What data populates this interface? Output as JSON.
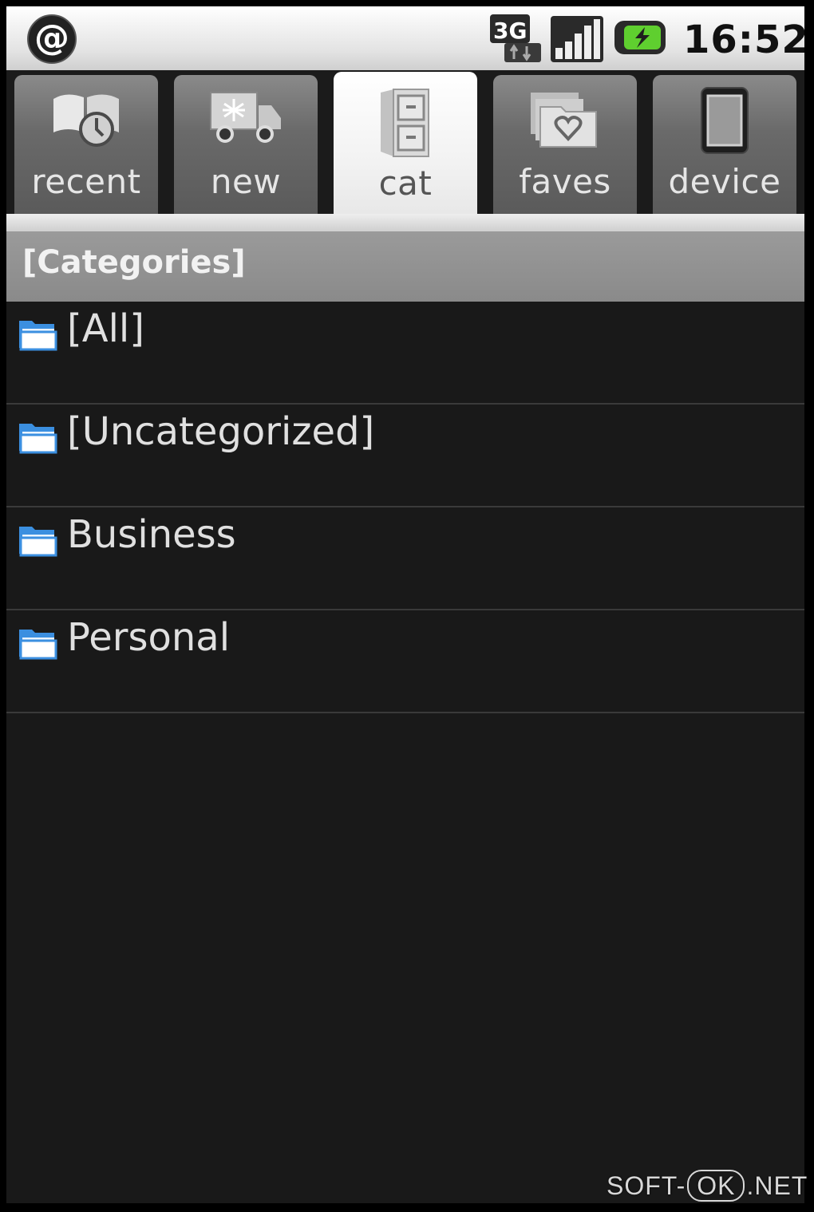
{
  "status_bar": {
    "notification_icon": "at-sign-icon",
    "network": "3G",
    "time": "16:52"
  },
  "tabs": [
    {
      "label": "recent",
      "icon": "book-clock-icon",
      "selected": false
    },
    {
      "label": "new",
      "icon": "delivery-truck-icon",
      "selected": false
    },
    {
      "label": "cat",
      "icon": "filing-cabinet-icon",
      "selected": true
    },
    {
      "label": "faves",
      "icon": "heart-folder-icon",
      "selected": false
    },
    {
      "label": "device",
      "icon": "phone-device-icon",
      "selected": false
    }
  ],
  "header": {
    "title": "[Categories]"
  },
  "categories": [
    {
      "label": "[All]"
    },
    {
      "label": "[Uncategorized]"
    },
    {
      "label": "Business"
    },
    {
      "label": "Personal"
    }
  ],
  "watermark": {
    "left": "SOFT-",
    "mid": "OK",
    "right": ".NET"
  },
  "colors": {
    "background": "#191919",
    "header": "#8f8f8f",
    "folder": "#3b8fe0",
    "selected_tab": "#f2f2f2"
  }
}
